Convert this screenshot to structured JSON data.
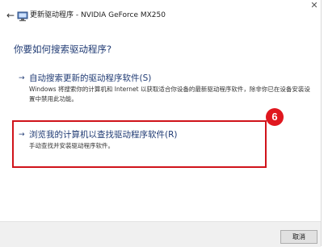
{
  "window": {
    "title": "更新驱动程序 - NVIDIA GeForce MX250",
    "back_glyph": "←",
    "close_glyph": "✕"
  },
  "heading": "你要如何搜索驱动程序?",
  "options": [
    {
      "arrow": "→",
      "title": "自动搜索更新的驱动程序软件(S)",
      "description": "Windows 将搜索你的计算机和 Internet 以获取适合你设备的最新驱动程序软件，除非你已在设备安装设置中禁用此功能。"
    },
    {
      "arrow": "→",
      "title": "浏览我的计算机以查找驱动程序软件(R)",
      "description": "手动查找并安装驱动程序软件。"
    }
  ],
  "annotation": {
    "step_number": "6",
    "color": "#d0131b"
  },
  "footer": {
    "cancel_label": "取消"
  },
  "colors": {
    "link_blue": "#1f3a73",
    "footer_bg": "#f0f0f0"
  }
}
